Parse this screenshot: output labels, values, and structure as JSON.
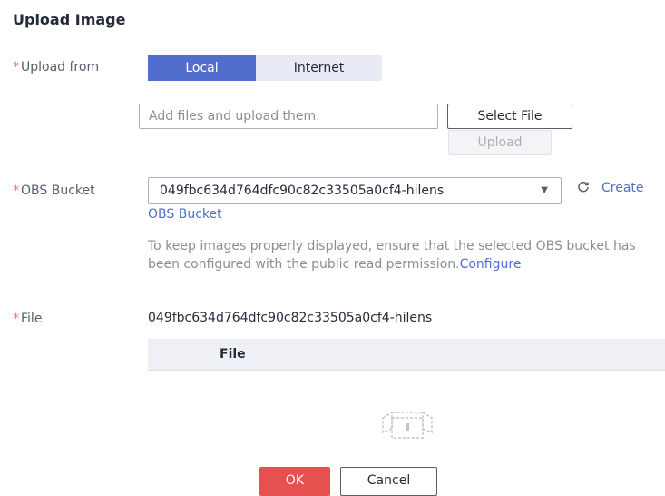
{
  "dialog": {
    "title": "Upload Image",
    "required_mark": "*",
    "upload_from": {
      "label": "Upload from",
      "options": [
        "Local",
        "Internet"
      ],
      "selected": "Local"
    },
    "file_input": {
      "placeholder": "Add files and upload them.",
      "select_button": "Select File",
      "upload_button": "Upload"
    },
    "obs_bucket": {
      "label": "OBS Bucket",
      "selected_value": "049fbc634d764dfc90c82c33505a0cf4-hilens",
      "create_link_part1": "Create",
      "create_link_part2": "OBS Bucket",
      "help_text": "To keep images properly displayed, ensure that the selected OBS bucket has been configured with the public read permission.",
      "configure_link": "Configure"
    },
    "file": {
      "label": "File",
      "value": "049fbc634d764dfc90c82c33505a0cf4-hilens",
      "table_header": "File"
    },
    "buttons": {
      "ok": "OK",
      "cancel": "Cancel"
    }
  },
  "colors": {
    "primary": "#526ecc",
    "danger": "#e6504f",
    "required": "#f66f6a"
  },
  "icons": [
    "refresh-icon",
    "dropdown-caret-icon",
    "empty-box-icon"
  ]
}
